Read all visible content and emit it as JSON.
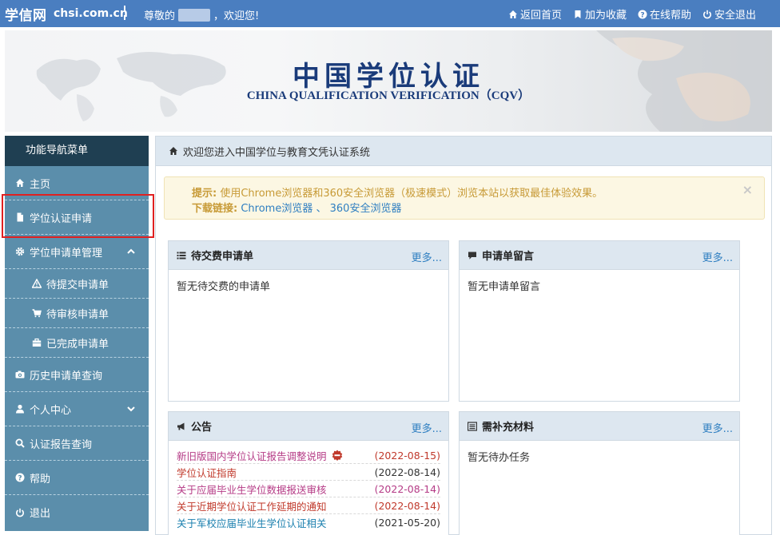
{
  "topbar": {
    "brand": "学信网",
    "brand_domain": "chsi.com.cn",
    "greeting_prefix": "尊敬的",
    "greeting_suffix": "，欢迎您!",
    "links": [
      {
        "label": "返回首页",
        "icon": "home-icon"
      },
      {
        "label": "加为收藏",
        "icon": "bookmark-icon"
      },
      {
        "label": "在线帮助",
        "icon": "help-icon"
      },
      {
        "label": "安全退出",
        "icon": "power-icon"
      }
    ]
  },
  "banner": {
    "title": "中国学位认证",
    "subtitle": "CHINA QUALIFICATION VERIFICATION（CQV）"
  },
  "sidebar": {
    "header": "功能导航菜单",
    "items": [
      {
        "label": "主页",
        "icon": "home-icon"
      },
      {
        "label": "学位认证申请",
        "icon": "file-icon"
      },
      {
        "label": "学位申请单管理",
        "icon": "gear-icon"
      },
      {
        "label": "待提交申请单",
        "icon": "warning-icon"
      },
      {
        "label": "待审核申请单",
        "icon": "cart-icon"
      },
      {
        "label": "已完成申请单",
        "icon": "briefcase-icon"
      },
      {
        "label": "历史申请单查询",
        "icon": "camera-icon"
      },
      {
        "label": "个人中心",
        "icon": "user-icon"
      },
      {
        "label": "认证报告查询",
        "icon": "search-icon"
      },
      {
        "label": "帮助",
        "icon": "help-icon"
      },
      {
        "label": "退出",
        "icon": "power-icon"
      }
    ]
  },
  "main": {
    "heading": "欢迎您进入中国学位与教育文凭认证系统",
    "alert": {
      "tip_label": "提示:",
      "tip_text": "使用Chrome浏览器和360安全浏览器（极速模式）浏览本站以获取最佳体验效果。",
      "download_label": "下载链接:",
      "link1": "Chrome浏览器",
      "sep": "、",
      "link2": "360安全浏览器",
      "close": "×"
    },
    "more_label": "更多...",
    "panels": {
      "unpaid": {
        "title": "待交费申请单",
        "empty": "暂无待交费的申请单"
      },
      "messages": {
        "title": "申请单留言",
        "empty": "暂无申请单留言"
      },
      "notice": {
        "title": "公告"
      },
      "supplement": {
        "title": "需补充材料",
        "empty": "暂无待办任务"
      }
    },
    "notices": [
      {
        "title": "新旧版国内学位认证报告调整说明",
        "date": "(2022-08-15)"
      },
      {
        "title": "学位认证指南",
        "date": "(2022-08-14)"
      },
      {
        "title": "关于应届毕业生学位数据报送审核",
        "date": "(2022-08-14)"
      },
      {
        "title": "关于近期学位认证工作延期的通知",
        "date": "(2022-08-14)"
      },
      {
        "title": "关于军校应届毕业生学位认证相关",
        "date": "(2021-05-20)"
      }
    ]
  }
}
